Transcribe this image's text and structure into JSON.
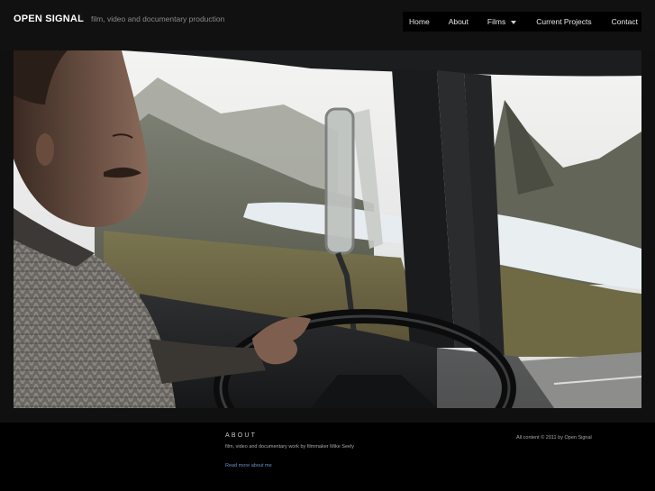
{
  "header": {
    "site_title": "OPEN SIGNAL",
    "tagline": "film, video and documentary production"
  },
  "nav": {
    "items": [
      {
        "label": "Home"
      },
      {
        "label": "About"
      },
      {
        "label": "Films",
        "has_dropdown": true
      },
      {
        "label": "Current Projects"
      },
      {
        "label": "Contact"
      }
    ]
  },
  "hero": {
    "image_description": "photo-of-man-driving-truck-past-mountain-lake"
  },
  "footer": {
    "about_heading": "ABOUT",
    "about_text": "film, video and documentary work by filmmaker Mike Seely",
    "read_more": "Read more about me",
    "copyright": "All content © 2011 by Open Signal"
  },
  "colors": {
    "background": "#101010",
    "nav_background": "#000000",
    "link": "#6d8fc9"
  }
}
